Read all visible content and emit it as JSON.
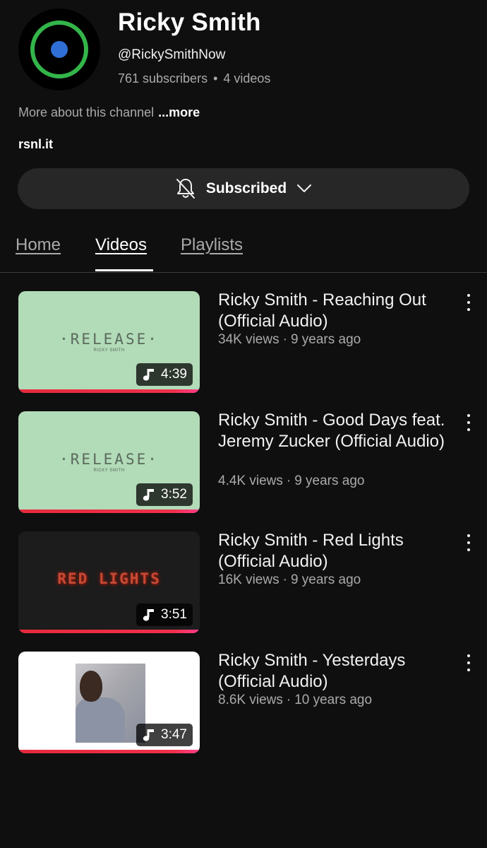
{
  "channel": {
    "name": "Ricky Smith",
    "handle": "@RickySmithNow",
    "subscribers": "761 subscribers",
    "separator": "•",
    "videos_count": "4 videos",
    "about": "More about this channel",
    "about_more": "...more",
    "link": "rsnl.it",
    "avatar_icon": "circle-logo-icon"
  },
  "subscribe": {
    "label": "Subscribed",
    "bell_icon": "bell-off-icon",
    "chevron_icon": "chevron-down-icon"
  },
  "tabs": [
    {
      "label": "Home",
      "active": false
    },
    {
      "label": "Videos",
      "active": true
    },
    {
      "label": "Playlists",
      "active": false
    }
  ],
  "videos": [
    {
      "title": "Ricky Smith - Reaching Out (Official Audio)",
      "views": "34K views",
      "age": "9 years ago",
      "duration": "4:39",
      "thumb_text": "·RELEASE·",
      "thumb_subtext": "RICKY SMITH",
      "watched_fraction": 1.0
    },
    {
      "title": "Ricky Smith - Good Days feat. Jeremy Zucker (Official Audio)",
      "views": "4.4K views",
      "age": "9 years ago",
      "duration": "3:52",
      "thumb_text": "·RELEASE·",
      "thumb_subtext": "RICKY SMITH",
      "watched_fraction": 1.0
    },
    {
      "title": "Ricky Smith - Red Lights (Official Audio)",
      "views": "16K views",
      "age": "9 years ago",
      "duration": "3:51",
      "thumb_text": "RED LIGHTS",
      "watched_fraction": 1.0
    },
    {
      "title": "Ricky Smith - Yesterdays (Official Audio)",
      "views": "8.6K views",
      "age": "10 years ago",
      "duration": "3:47",
      "watched_fraction": 1.0
    }
  ],
  "meta_separator": "·",
  "colors": {
    "background": "#0f0f0f",
    "accent_ring": "#33b54a",
    "avatar_dot": "#2f6fd6",
    "progress": "#f0304a",
    "thumb_green": "#b2dbb8"
  }
}
